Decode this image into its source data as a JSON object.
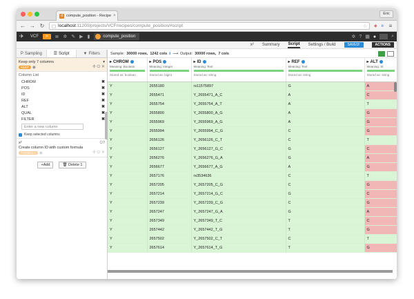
{
  "browser": {
    "tab_title": "compute_position - Recipe",
    "tab_close": "×",
    "user": "Eric",
    "url_host": "localhost",
    "url_path": ":11200/projects/VCF/recipes/compute_position/#script"
  },
  "appbar": {
    "project": "VCF",
    "recipe_name": "compute_position"
  },
  "subnav": {
    "tabs": [
      "x²",
      "Summary",
      "Script",
      "Settings / Build"
    ],
    "active": "Script",
    "saved_label": "SAVED!",
    "actions_label": "ACTIONS"
  },
  "left": {
    "tabs": [
      "Sampling",
      "Script",
      "Filters"
    ],
    "step1_title": "Keep only 7 columns",
    "step1_badge": "KEEP",
    "column_list_label": "Column List",
    "columns": [
      "CHROM",
      "POS",
      "ID",
      "REF",
      "ALT",
      "QUAL",
      "FILTER"
    ],
    "new_column_placeholder": "Enter a new column",
    "keep_selected_label": "Keep selected columns",
    "step2_icon": "x²",
    "step2_title": "Create column ID with custom formula",
    "step2_badge": "FORMULA",
    "add_label": "+Add",
    "delete_label": "Delete 1"
  },
  "sample": {
    "prefix": "Sample:",
    "rows": "30000 rows,",
    "cols": "1242 cols",
    "arrow": "⟶",
    "output_label": "Output:",
    "out_rows": "30000 rows,",
    "out_cols": "7 cols"
  },
  "table": {
    "headers": [
      {
        "name": "CHROM",
        "meaning": "Meaning: Boolean",
        "stored": "Stored as: boolean"
      },
      {
        "name": "POS",
        "meaning": "Meaning: Integer",
        "stored": "Stored as: bigint"
      },
      {
        "name": "ID",
        "meaning": "Meaning: Text",
        "stored": "Stored as: string"
      },
      {
        "name": "REF",
        "meaning": "Meaning: Text",
        "stored": "Stored as: string"
      },
      {
        "name": "ALT",
        "meaning": "Meaning: St",
        "stored": "Stored as: string"
      }
    ],
    "rows": [
      [
        "Y",
        "2655180",
        "rs11575897",
        "G",
        "A"
      ],
      [
        "Y",
        "2655471",
        "Y_2655471_A_C",
        "A",
        "C"
      ],
      [
        "Y",
        "2655754",
        "Y_2655754_A_T",
        "A",
        "T"
      ],
      [
        "Y",
        "2655800",
        "Y_2655800_A_G",
        "A",
        "G"
      ],
      [
        "Y",
        "2655969",
        "Y_2655969_A_G",
        "A",
        "G"
      ],
      [
        "Y",
        "2655994",
        "Y_2655994_C_G",
        "C",
        "G"
      ],
      [
        "Y",
        "2656126",
        "Y_2656126_C_T",
        "C",
        "T"
      ],
      [
        "Y",
        "2656127",
        "Y_2656127_G_C",
        "G",
        "C"
      ],
      [
        "Y",
        "2656276",
        "Y_2656276_G_A",
        "G",
        "A"
      ],
      [
        "Y",
        "2656677",
        "Y_2656677_A_G",
        "A",
        "G"
      ],
      [
        "Y",
        "2657176",
        "rs3534636",
        "C",
        "T"
      ],
      [
        "Y",
        "2657205",
        "Y_2657205_C_G",
        "C",
        "G"
      ],
      [
        "Y",
        "2657214",
        "Y_2657214_G_C",
        "G",
        "C"
      ],
      [
        "Y",
        "2657239",
        "Y_2657239_C_G",
        "C",
        "G"
      ],
      [
        "Y",
        "2657247",
        "Y_2657247_G_A",
        "G",
        "A"
      ],
      [
        "Y",
        "2657349",
        "Y_2657349_T_C",
        "T",
        "C"
      ],
      [
        "Y",
        "2657442",
        "Y_2657442_T_G",
        "T",
        "G"
      ],
      [
        "Y",
        "2657502",
        "Y_2657502_C_T",
        "C",
        "T"
      ],
      [
        "Y",
        "2657614",
        "Y_2657614_T_G",
        "T",
        "G"
      ]
    ]
  }
}
